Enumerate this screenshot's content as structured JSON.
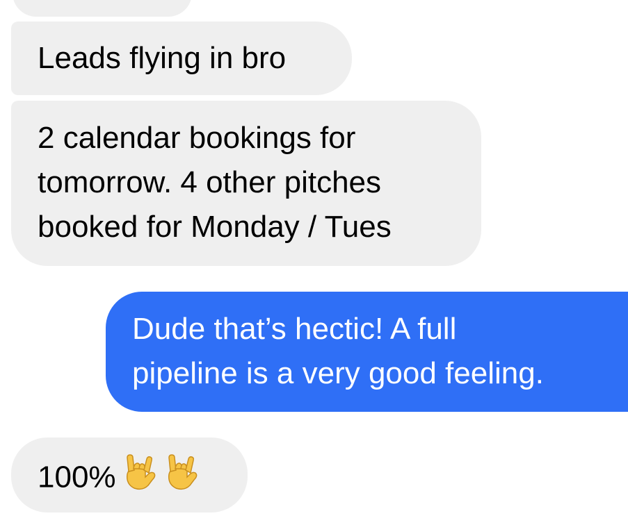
{
  "messages": [
    {
      "direction": "incoming",
      "lines": []
    },
    {
      "direction": "incoming",
      "lines": [
        "Leads flying in bro"
      ]
    },
    {
      "direction": "incoming",
      "lines": [
        "2 calendar bookings for",
        "tomorrow. 4 other pitches",
        "booked for Monday / Tues"
      ]
    },
    {
      "direction": "outgoing",
      "lines": [
        "Dude that’s hectic! A full",
        "pipeline is a very good feeling."
      ]
    },
    {
      "direction": "incoming",
      "text": "100%",
      "emoji": [
        "love-you-gesture-icon",
        "love-you-gesture-icon"
      ]
    }
  ],
  "colors": {
    "incoming_bubble": "#efefef",
    "outgoing_bubble": "#2f6ff6",
    "emoji_yellow": "#f6c446"
  }
}
